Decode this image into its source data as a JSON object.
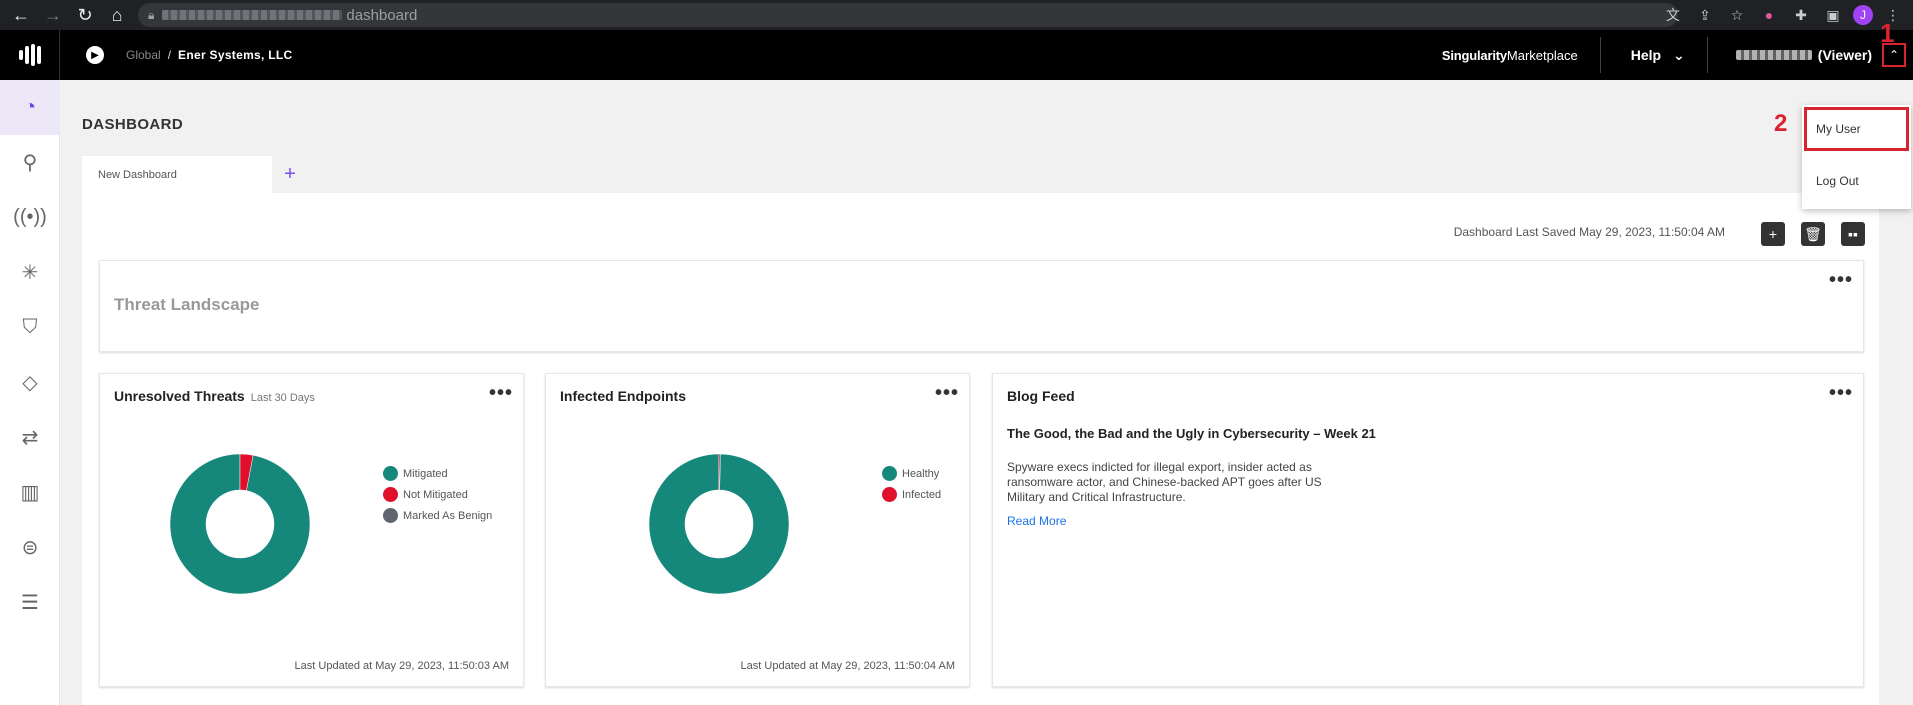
{
  "browser": {
    "url_path": "dashboard",
    "profile_initial": "J"
  },
  "header": {
    "breadcrumb_global": "Global",
    "breadcrumb_sep": "/",
    "company": "Ener Systems, LLC",
    "marketplace_bold": "Singularity",
    "marketplace_rest": "Marketplace",
    "help": "Help",
    "user_role": "(Viewer)"
  },
  "page": {
    "title": "DASHBOARD",
    "tab": "New Dashboard",
    "tab_add": "+",
    "saved_text": "Dashboard Last Saved May 29, 2023, 11:50:04 AM"
  },
  "panels": {
    "threat_landscape": {
      "title": "Threat Landscape"
    },
    "unresolved": {
      "title": "Unresolved Threats",
      "subtitle": "Last 30 Days",
      "legend": [
        "Mitigated",
        "Not Mitigated",
        "Marked As Benign"
      ],
      "updated": "Last Updated at May 29, 2023, 11:50:03 AM"
    },
    "infected": {
      "title": "Infected Endpoints",
      "legend": [
        "Healthy",
        "Infected"
      ],
      "updated": "Last Updated at May 29, 2023, 11:50:04 AM"
    },
    "blog": {
      "title": "Blog Feed",
      "headline": "The Good, the Bad and the Ugly in Cybersecurity – Week 21",
      "body": "Spyware execs indicted for illegal export, insider acted as ransomware actor, and Chinese-backed APT goes after US Military and Critical Infrastructure.",
      "link": "Read More"
    }
  },
  "dropdown": {
    "my_user": "My User",
    "log_out": "Log Out"
  },
  "annotations": {
    "one": "1",
    "two": "2"
  },
  "colors": {
    "teal": "#16877b",
    "red": "#e0102d",
    "gray": "#5f6670",
    "accent": "#6f3fe0",
    "highlight": "#d9232e"
  },
  "chart_data": [
    {
      "type": "pie",
      "categories": [
        "Mitigated",
        "Not Mitigated",
        "Marked As Benign"
      ],
      "values": [
        97,
        3,
        0
      ]
    },
    {
      "type": "pie",
      "categories": [
        "Healthy",
        "Infected"
      ],
      "values": [
        99.7,
        0.3
      ]
    }
  ]
}
